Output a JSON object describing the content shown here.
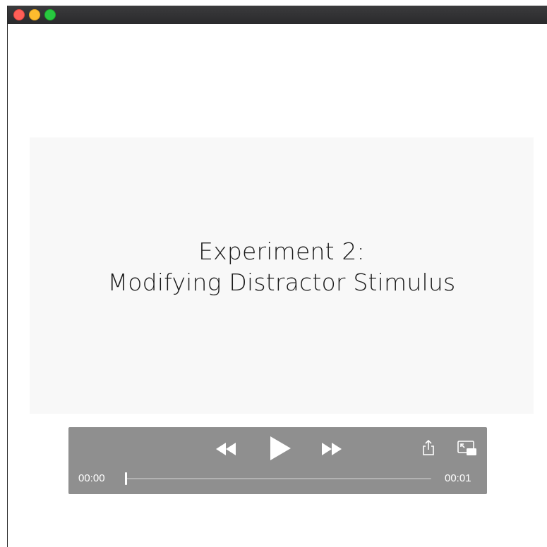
{
  "window": {
    "traffic_lights": {
      "close": "#fe5f57",
      "minimize": "#febc2e",
      "maximize": "#28c840"
    }
  },
  "slide": {
    "title_line1": "Experiment 2:",
    "title_line2": "Modifying Distractor Stimulus"
  },
  "player": {
    "elapsed_time": "00:00",
    "total_time": "00:01",
    "progress": 0,
    "icons": {
      "rewind": "rewind-icon",
      "play": "play-icon",
      "fast_forward": "fast-forward-icon",
      "share": "share-icon",
      "pip": "picture-in-picture-icon"
    }
  }
}
